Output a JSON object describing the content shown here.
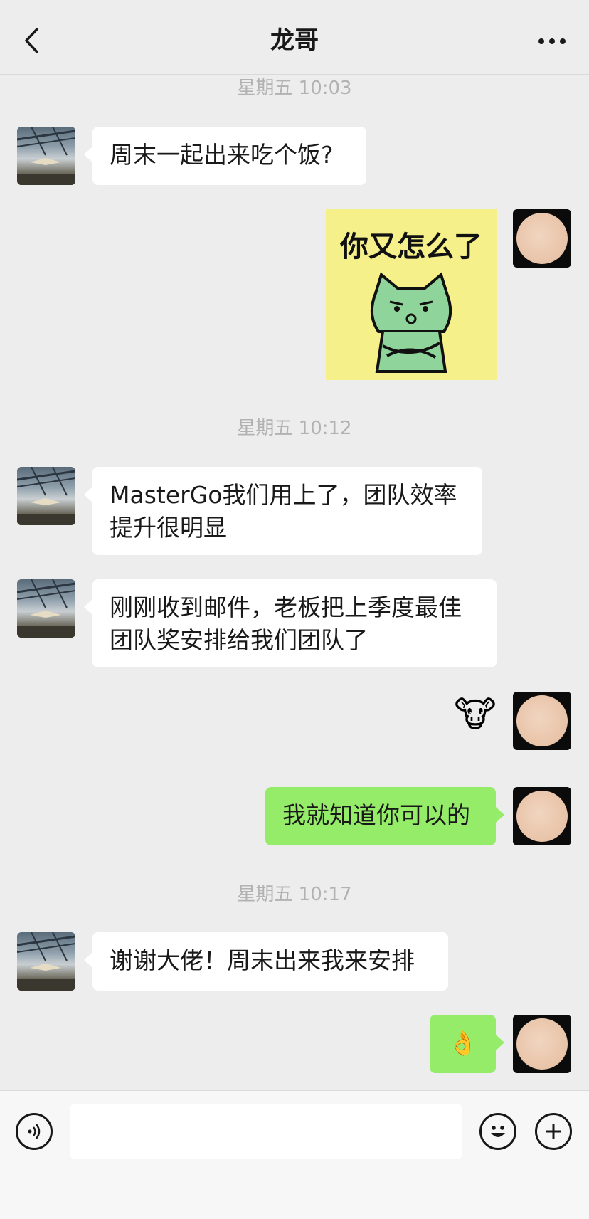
{
  "header": {
    "title": "龙哥"
  },
  "icons": {
    "back": "back-chevron-icon",
    "more": "more-dots-icon",
    "voice": "voice-icon",
    "emoji": "emoji-icon",
    "plus": "plus-icon"
  },
  "timestamps": [
    "星期五 10:03",
    "星期五 10:12",
    "星期五 10:17"
  ],
  "messages": [
    {
      "side": "in",
      "text": "周末一起出来吃个饭?"
    },
    {
      "side": "out",
      "type": "sticker",
      "sticker_text": "你又怎么了"
    },
    {
      "side": "in",
      "text": "MasterGo我们用上了，团队效率提升很明显"
    },
    {
      "side": "in",
      "text": "刚刚收到邮件，老板把上季度最佳团队奖安排给我们团队了"
    },
    {
      "side": "out",
      "type": "emoji",
      "emoji": "🐮"
    },
    {
      "side": "out",
      "text": "我就知道你可以的"
    },
    {
      "side": "in",
      "text": "谢谢大佬！周末出来我来安排"
    },
    {
      "side": "out",
      "type": "emoji",
      "emoji": "👌"
    }
  ],
  "input": {
    "placeholder": ""
  },
  "colors": {
    "background": "#ededed",
    "outgoing_bubble": "#95ec69",
    "incoming_bubble": "#ffffff",
    "timestamp": "#b2b2b2"
  }
}
